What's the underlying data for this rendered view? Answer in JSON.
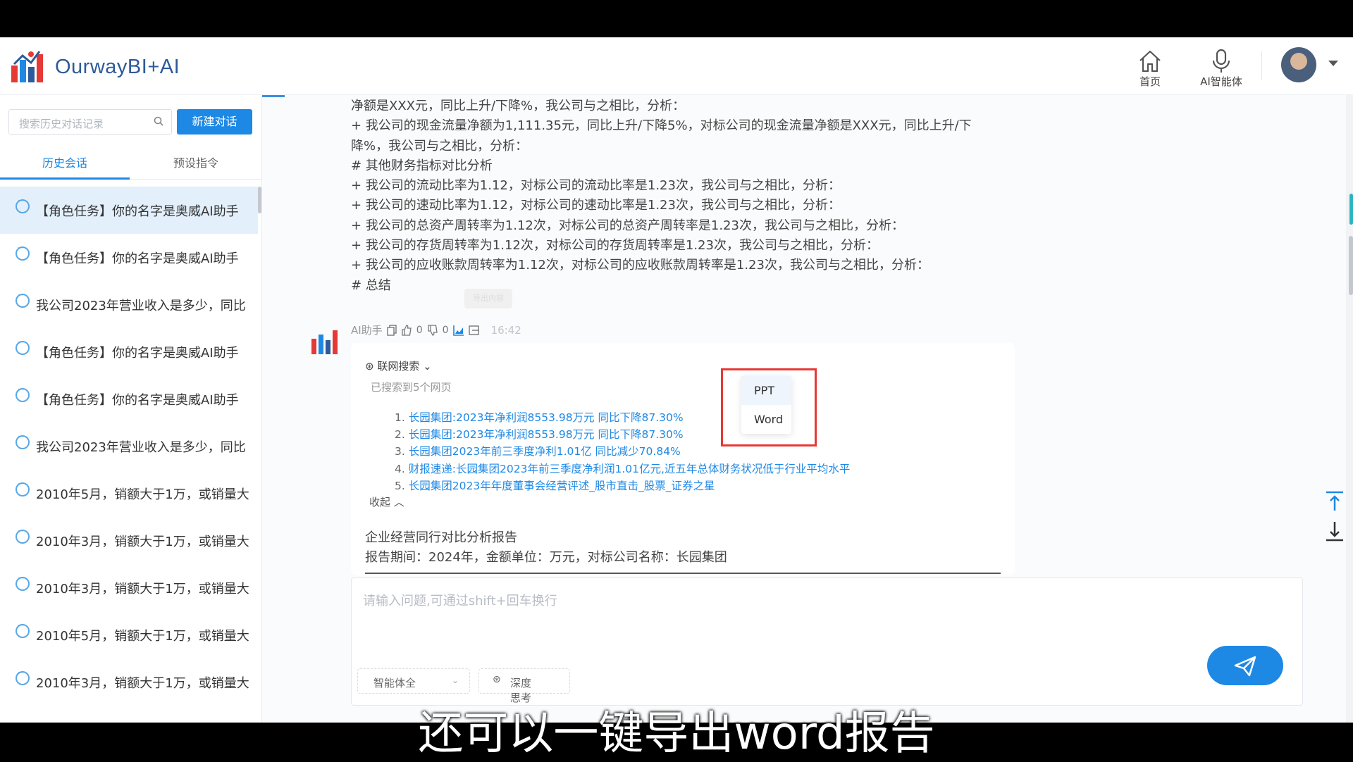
{
  "header": {
    "app_name": "OurwayBI+AI",
    "home_label": "首页",
    "agent_label": "AI智能体"
  },
  "sidebar": {
    "search_placeholder": "搜索历史对话记录",
    "new_chat_label": "新建对话",
    "tabs": [
      "历史会话",
      "预设指令"
    ],
    "items": [
      "【角色任务】你的名字是奥威AI助手",
      "【角色任务】你的名字是奥威AI助手",
      "我公司2023年营业收入是多少，同比",
      "【角色任务】你的名字是奥威AI助手",
      "【角色任务】你的名字是奥威AI助手",
      "我公司2023年营业收入是多少，同比",
      "2010年5月，销额大于1万，或销量大",
      "2010年3月，销额大于1万，或销量大",
      "2010年3月，销额大于1万，或销量大",
      "2010年5月，销额大于1万，或销量大",
      "2010年3月，销额大于1万，或销量大"
    ]
  },
  "message": {
    "lines": [
      "净额是XXX元，同比上升/下降%，我公司与之相比，分析：",
      "+ 我公司的现金流量净额为1,111.35元，同比上升/下降5%，对标公司的现金流量净额是XXX元，同比上升/下",
      "降%，我公司与之相比，分析：",
      "# 其他财务指标对比分析",
      "+ 我公司的流动比率为1.12，对标公司的流动比率是1.23次，我公司与之相比，分析：",
      "+ 我公司的速动比率为1.12，对标公司的速动比率是1.23次，我公司与之相比，分析：",
      "+ 我公司的总资产周转率为1.12次，对标公司的总资产周转率是1.23次，我公司与之相比，分析：",
      "+ 我公司的存货周转率为1.12次，对标公司的存货周转率是1.23次，我公司与之相比，分析：",
      "+ 我公司的应收账款周转率为1.12次，对标公司的应收账款周转率是1.23次，我公司与之相比，分析：",
      "# 总结"
    ]
  },
  "ai_reply": {
    "sender": "AI助手",
    "likes": "0",
    "dislikes": "0",
    "time": "16:42",
    "tooltip": "导出内容",
    "web_search_label": "联网搜索",
    "searched_label": "已搜索到5个网页",
    "sources": [
      "长园集团:2023年净利润8553.98万元 同比下降87.30%",
      "长园集团:2023年净利润8553.98万元 同比下降87.30%",
      "长园集团2023年前三季度净利1.01亿 同比减少70.84%",
      "财报速递:长园集团2023年前三季度净利润1.01亿元,近五年总体财务状况低于行业平均水平",
      "长园集团2023年年度董事会经营评述_股市直击_股票_证券之星"
    ],
    "collapse_label": "收起",
    "report_title": "企业经营同行对比分析报告",
    "report_sub": "报告期间：2024年，金额单位：万元，对标公司名称：长园集团"
  },
  "export_menu": {
    "items": [
      "PPT",
      "Word"
    ]
  },
  "input": {
    "placeholder": "请输入问题,可通过shift+回车换行",
    "mode_label": "智能体全",
    "deep_label": "深度思考"
  },
  "subtitle": "还可以一键导出word报告",
  "colors": {
    "accent": "#1e88e5",
    "highlight_box": "#e53935"
  }
}
